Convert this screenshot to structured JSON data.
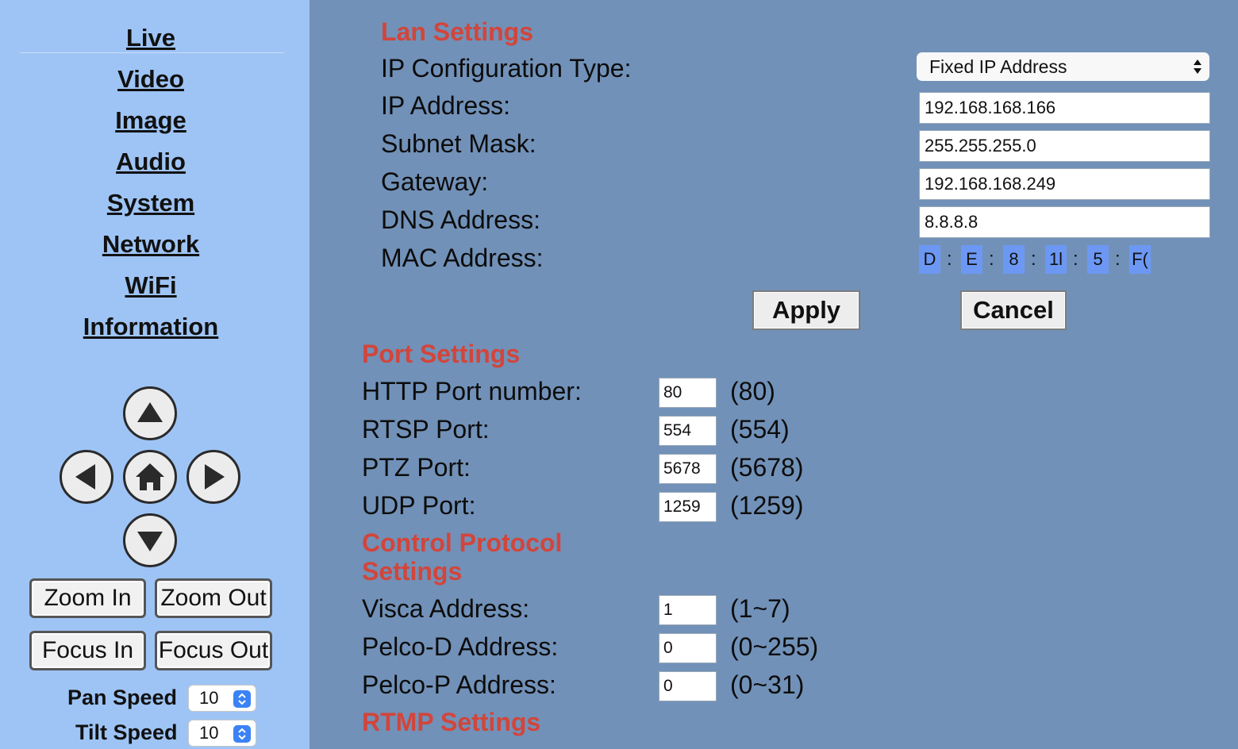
{
  "sidebar": {
    "nav": [
      "Live",
      "Video",
      "Image",
      "Audio",
      "System",
      "Network",
      "WiFi",
      "Information"
    ],
    "zoom_in": "Zoom In",
    "zoom_out": "Zoom Out",
    "focus_in": "Focus In",
    "focus_out": "Focus Out",
    "pan_speed_label": "Pan Speed",
    "pan_speed_value": "10",
    "tilt_speed_label": "Tilt Speed",
    "tilt_speed_value": "10"
  },
  "lan": {
    "heading": "Lan Settings",
    "ip_config_label": "IP Configuration Type:",
    "ip_config_value": "Fixed IP Address",
    "ip_label": "IP Address:",
    "ip_value": "192.168.168.166",
    "mask_label": "Subnet Mask:",
    "mask_value": "255.255.255.0",
    "gateway_label": "Gateway:",
    "gateway_value": "192.168.168.249",
    "dns_label": "DNS Address:",
    "dns_value": "8.8.8.8",
    "mac_label": "MAC Address:",
    "mac_segments": [
      "D",
      "E",
      "8",
      "1l",
      "5",
      "F("
    ],
    "mac_separator": ":",
    "apply": "Apply",
    "cancel": "Cancel"
  },
  "ports": {
    "heading": "Port Settings",
    "http_label": "HTTP Port number:",
    "http_value": "80",
    "http_hint": "(80)",
    "rtsp_label": "RTSP Port:",
    "rtsp_value": "554",
    "rtsp_hint": "(554)",
    "ptz_label": "PTZ Port:",
    "ptz_value": "5678",
    "ptz_hint": "(5678)",
    "udp_label": "UDP Port:",
    "udp_value": "1259",
    "udp_hint": "(1259)"
  },
  "control": {
    "heading_line1": "Control Protocol",
    "heading_line2": "Settings",
    "visca_label": "Visca Address:",
    "visca_value": "1",
    "visca_hint": "(1~7)",
    "pelcod_label": "Pelco-D Address:",
    "pelcod_value": "0",
    "pelcod_hint": "(0~255)",
    "pelcop_label": "Pelco-P Address:",
    "pelcop_value": "0",
    "pelcop_hint": "(0~31)"
  },
  "rtmp": {
    "heading": "RTMP Settings"
  },
  "icons": {
    "ptz_up": "arrow-up-icon",
    "ptz_down": "arrow-down-icon",
    "ptz_left": "arrow-left-icon",
    "ptz_right": "arrow-right-icon",
    "ptz_home": "home-icon",
    "select": "updown-arrows-icon"
  },
  "colors": {
    "sidebar_bg": "#9ec4f5",
    "main_bg": "#7191b8",
    "heading": "#d2453b",
    "mac_highlight": "#6c98f4",
    "spinner_accent": "#3b82f6"
  }
}
